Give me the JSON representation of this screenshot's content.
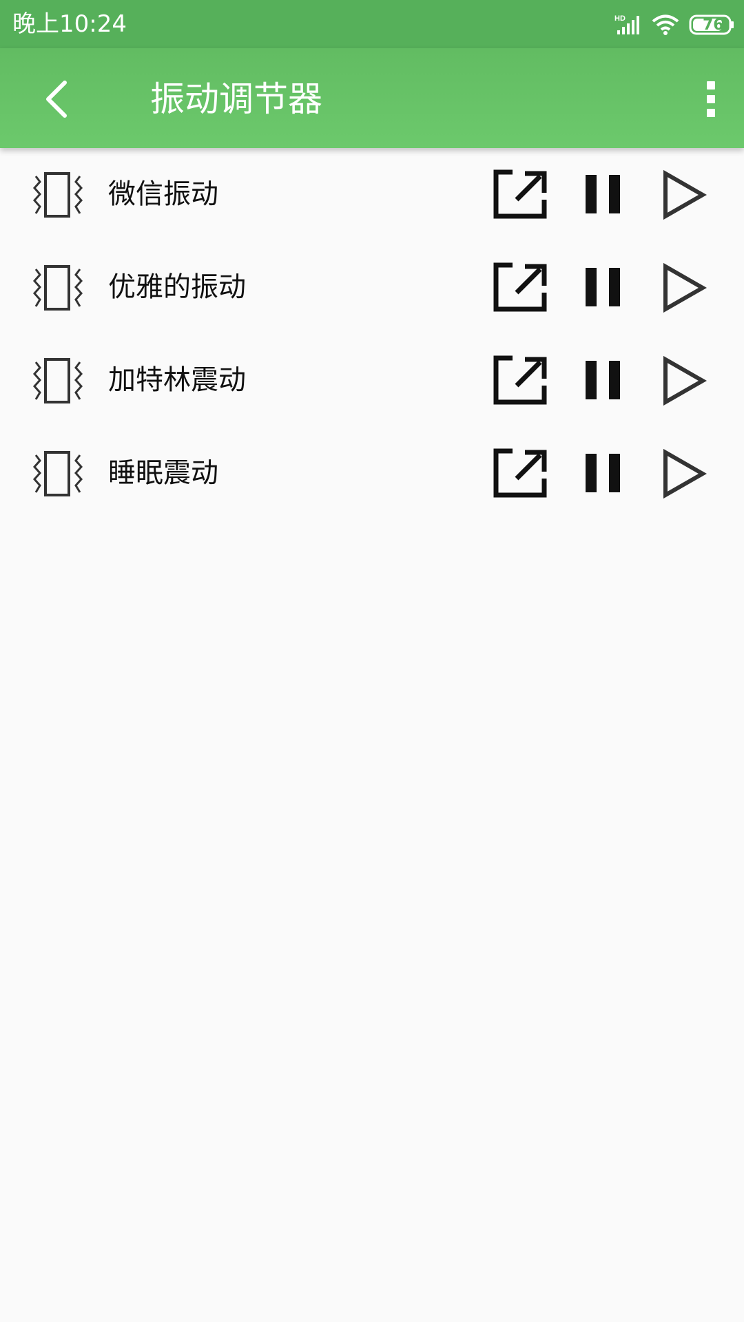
{
  "status_bar": {
    "time": "晚上10:24",
    "signal_label": "HD",
    "battery": "76",
    "icons": [
      "hd-signal-icon",
      "wifi-icon",
      "battery-icon"
    ]
  },
  "app_bar": {
    "title": "振动调节器",
    "back_icon": "chevron-left-icon",
    "more_icon": "more-vertical-icon"
  },
  "items": [
    {
      "label": "微信振动",
      "icon": "vibration-icon"
    },
    {
      "label": "优雅的振动",
      "icon": "vibration-icon"
    },
    {
      "label": "加特林震动",
      "icon": "vibration-icon"
    },
    {
      "label": "睡眠震动",
      "icon": "vibration-icon"
    }
  ],
  "item_actions": [
    "open-external-icon",
    "pause-icon",
    "play-icon"
  ],
  "colors": {
    "status_bar": "#56b05a",
    "app_bar": "#66c266",
    "background": "#fafafa",
    "icon": "#333333"
  }
}
